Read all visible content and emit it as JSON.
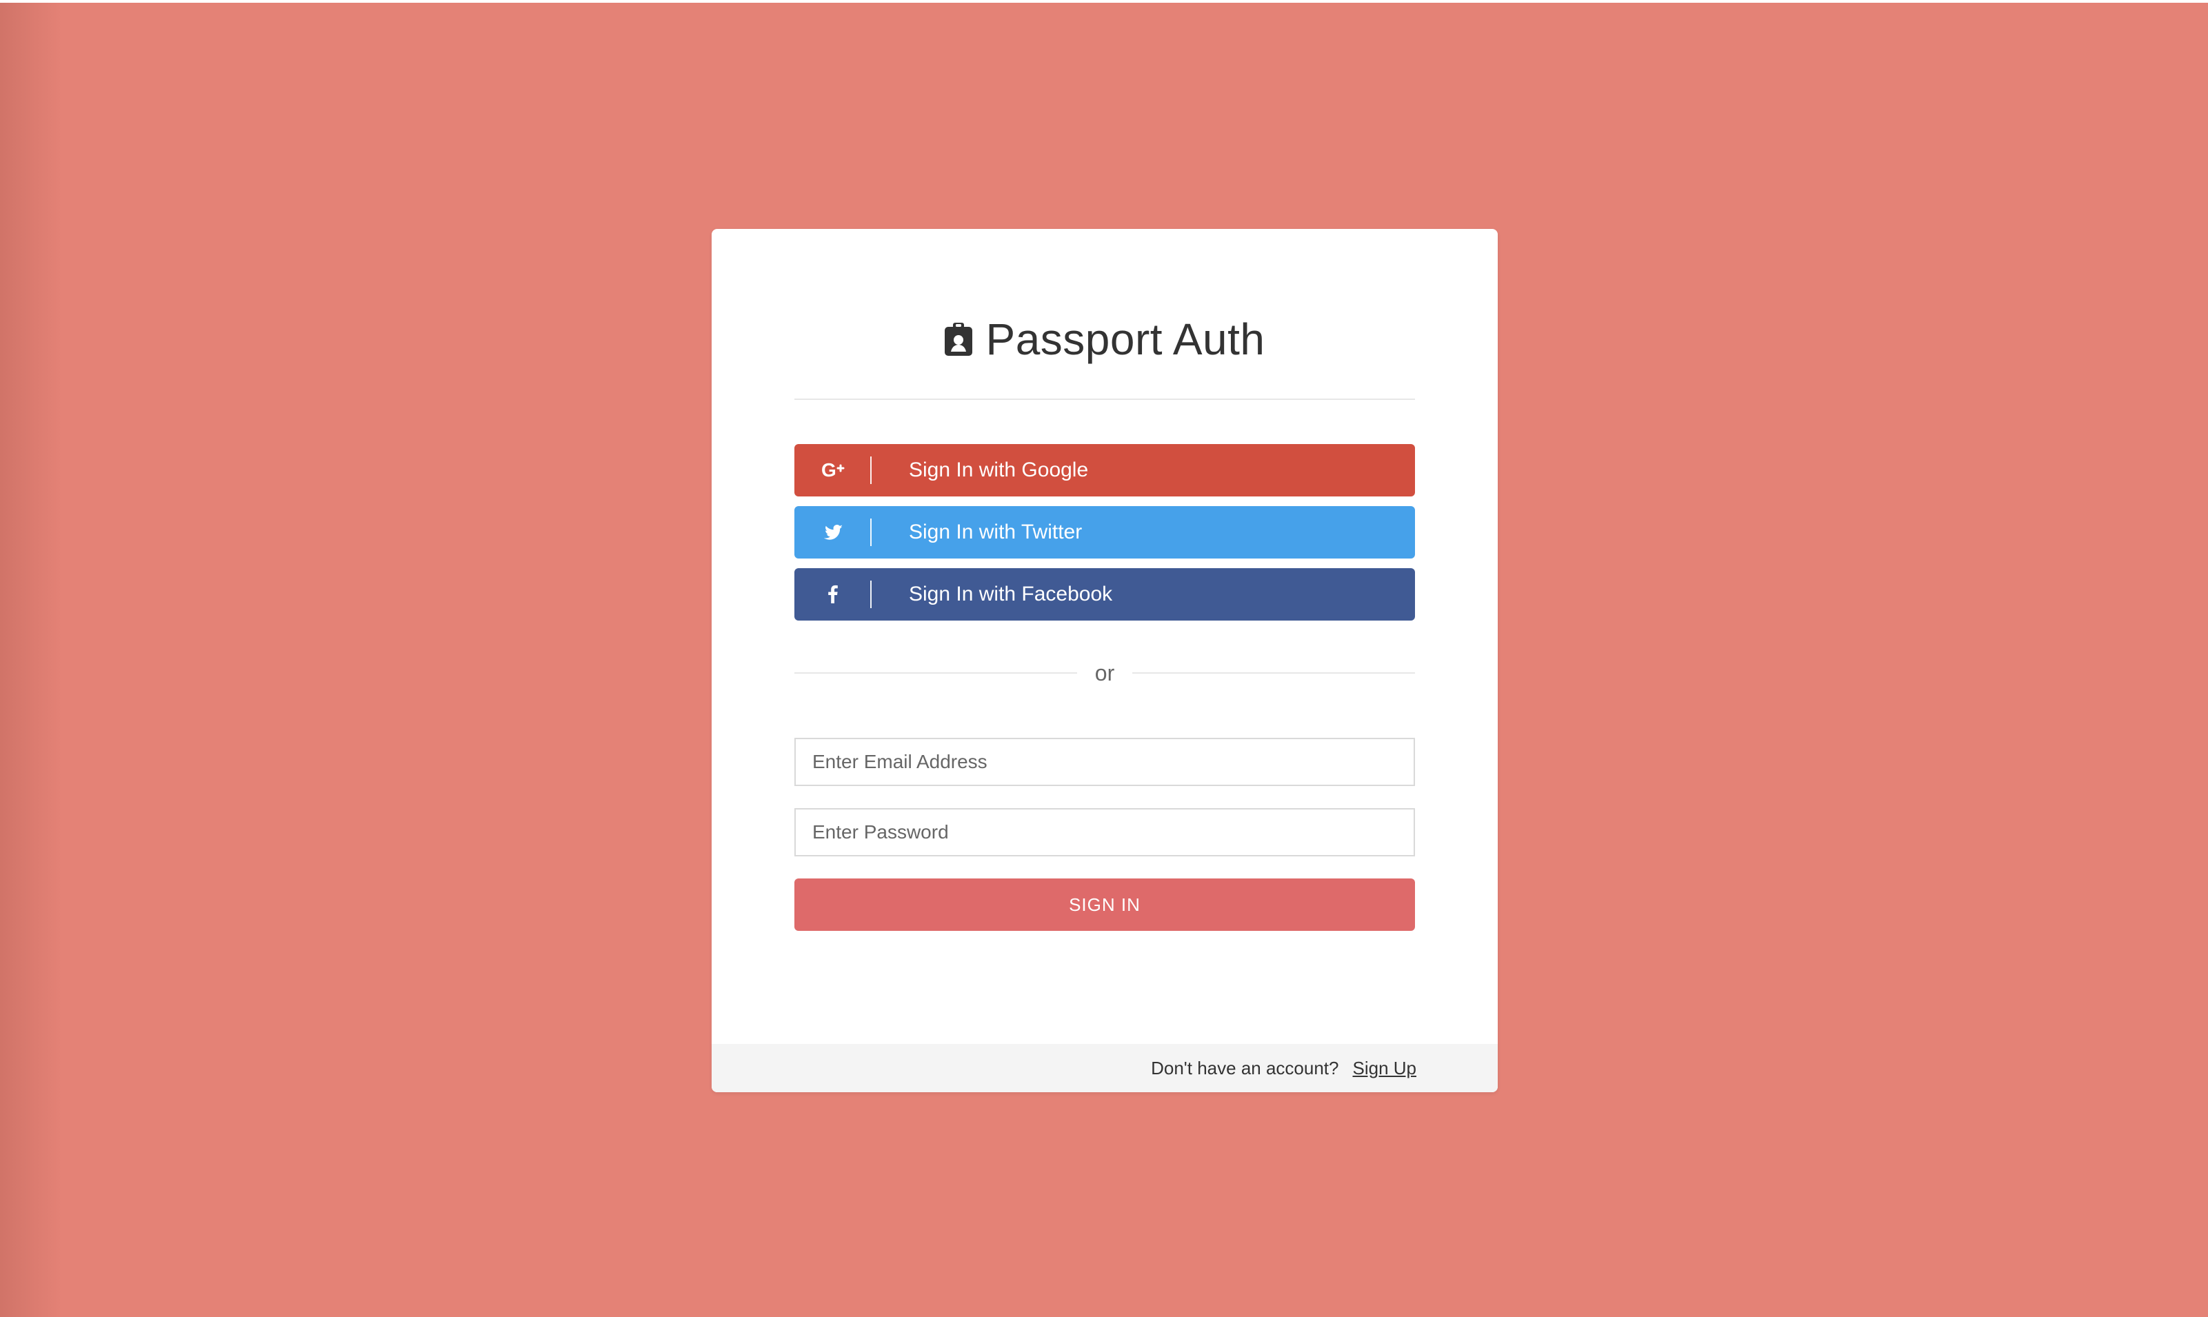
{
  "page": {
    "background_color": "#e48276"
  },
  "header": {
    "title": "Passport Auth",
    "icon": "id-badge-icon"
  },
  "social": {
    "google": {
      "label": "Sign In with Google",
      "icon": "google-plus-icon",
      "color": "#d14f3f"
    },
    "twitter": {
      "label": "Sign In with Twitter",
      "icon": "twitter-icon",
      "color": "#46a1ea"
    },
    "facebook": {
      "label": "Sign In with Facebook",
      "icon": "facebook-icon",
      "color": "#405a94"
    }
  },
  "divider": {
    "text": "or"
  },
  "form": {
    "email_placeholder": "Enter Email Address",
    "password_placeholder": "Enter Password",
    "submit_label": "SIGN IN",
    "submit_color": "#de6a6a"
  },
  "footer": {
    "prompt": "Don't have an account?",
    "link": "Sign Up"
  }
}
